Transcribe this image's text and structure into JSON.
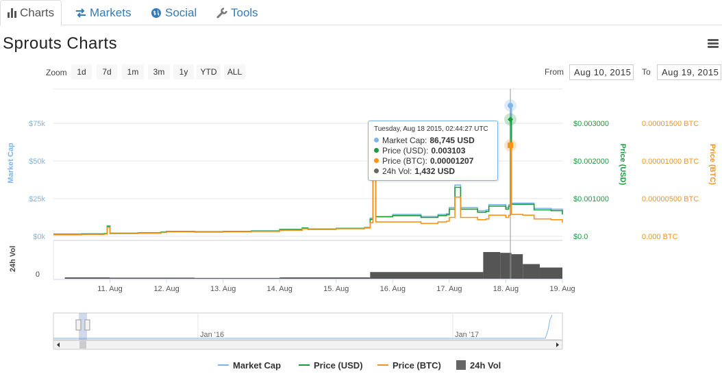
{
  "tabs": [
    {
      "label": "Charts",
      "icon": "bar-chart-icon",
      "active": true
    },
    {
      "label": "Markets",
      "icon": "exchange-icon",
      "active": false
    },
    {
      "label": "Social",
      "icon": "globe-icon",
      "active": false
    },
    {
      "label": "Tools",
      "icon": "wrench-icon",
      "active": false
    }
  ],
  "page": {
    "title": "Sprouts Charts"
  },
  "range_selector": {
    "zoom_label": "Zoom",
    "buttons": [
      "1d",
      "7d",
      "1m",
      "3m",
      "1y",
      "YTD",
      "ALL"
    ],
    "from_label": "From",
    "from_value": "Aug 10, 2015",
    "to_label": "To",
    "to_value": "Aug 19, 2015"
  },
  "tooltip": {
    "header": "Tuesday, Aug 18 2015, 02:44:27 UTC",
    "rows": [
      {
        "label": "Market Cap:",
        "value": "86,745 USD",
        "color": "#7cb5ec"
      },
      {
        "label": "Price (USD):",
        "value": "0.003103",
        "color": "#1a9b3c"
      },
      {
        "label": "Price (BTC):",
        "value": "0.00001207",
        "color": "#f7931a"
      },
      {
        "label": "24h Vol:",
        "value": "1,432 USD",
        "color": "#666666"
      }
    ]
  },
  "chart_data": {
    "type": "line",
    "colors": {
      "market_cap": "#7cb5ec",
      "price_usd": "#1a9b3c",
      "price_btc": "#f7931a",
      "volume": "#555555"
    },
    "x_ticks": [
      "11. Aug",
      "12. Aug",
      "13. Aug",
      "14. Aug",
      "15. Aug",
      "16. Aug",
      "17. Aug",
      "18. Aug",
      "19. Aug"
    ],
    "x_range_days": [
      10.0,
      19.0
    ],
    "axes": {
      "market_cap": {
        "title": "Market Cap",
        "ticks": [
          "$0k",
          "$25k",
          "$50k",
          "$75k"
        ],
        "range": [
          0,
          75000
        ]
      },
      "price_usd": {
        "title": "Price (USD)",
        "ticks": [
          "$0.0",
          "$0.001000",
          "$0.002000",
          "$0.003000"
        ],
        "range": [
          0,
          0.003
        ]
      },
      "price_btc": {
        "title": "Price (BTC)",
        "ticks": [
          "0.000 BTC",
          "0.00000500 BTC",
          "0.00001000 BTC",
          "0.00001500 BTC"
        ],
        "range": [
          0,
          1.5e-05
        ]
      },
      "volume": {
        "title": "24h Vol",
        "ticks": [
          "0"
        ]
      }
    },
    "series": [
      {
        "name": "Market Cap",
        "key": "market_cap",
        "points": [
          [
            10.0,
            1500
          ],
          [
            10.5,
            1700
          ],
          [
            10.9,
            1800
          ],
          [
            10.95,
            7000
          ],
          [
            11.0,
            2000
          ],
          [
            11.5,
            2300
          ],
          [
            11.9,
            2800
          ],
          [
            12.0,
            3200
          ],
          [
            12.5,
            3000
          ],
          [
            13.0,
            3200
          ],
          [
            13.5,
            3600
          ],
          [
            14.0,
            4500
          ],
          [
            14.4,
            5500
          ],
          [
            14.5,
            4800
          ],
          [
            15.0,
            5200
          ],
          [
            15.5,
            5800
          ],
          [
            15.6,
            12000
          ],
          [
            15.65,
            72000
          ],
          [
            15.7,
            13000
          ],
          [
            16.0,
            14500
          ],
          [
            16.5,
            13200
          ],
          [
            16.8,
            14500
          ],
          [
            16.95,
            15000
          ],
          [
            17.0,
            19000
          ],
          [
            17.1,
            34000
          ],
          [
            17.2,
            19000
          ],
          [
            17.5,
            17000
          ],
          [
            17.65,
            17500
          ],
          [
            17.7,
            21000
          ],
          [
            18.0,
            19000
          ],
          [
            18.05,
            21000
          ],
          [
            18.08,
            86745
          ],
          [
            18.1,
            22000
          ],
          [
            18.3,
            22000
          ],
          [
            18.5,
            18500
          ],
          [
            18.8,
            18000
          ],
          [
            19.0,
            15500
          ]
        ]
      },
      {
        "name": "Price (USD)",
        "key": "price_usd",
        "points": [
          [
            10.0,
            5e-05
          ],
          [
            10.5,
            6e-05
          ],
          [
            10.9,
            7e-05
          ],
          [
            10.95,
            0.00026
          ],
          [
            11.0,
            8e-05
          ],
          [
            11.5,
            9e-05
          ],
          [
            11.9,
            0.00011
          ],
          [
            12.0,
            0.00013
          ],
          [
            12.5,
            0.00012
          ],
          [
            13.0,
            0.00013
          ],
          [
            13.5,
            0.00014
          ],
          [
            14.0,
            0.00018
          ],
          [
            14.4,
            0.00022
          ],
          [
            14.5,
            0.00019
          ],
          [
            15.0,
            0.00021
          ],
          [
            15.5,
            0.00023
          ],
          [
            15.6,
            0.00045
          ],
          [
            15.65,
            0.00275
          ],
          [
            15.7,
            0.00052
          ],
          [
            16.0,
            0.00055
          ],
          [
            16.5,
            0.0005
          ],
          [
            16.8,
            0.00055
          ],
          [
            16.95,
            0.00057
          ],
          [
            17.0,
            0.00072
          ],
          [
            17.1,
            0.0013
          ],
          [
            17.2,
            0.00072
          ],
          [
            17.5,
            0.00064
          ],
          [
            17.65,
            0.00066
          ],
          [
            17.7,
            0.0008
          ],
          [
            18.0,
            0.00072
          ],
          [
            18.05,
            0.0008
          ],
          [
            18.08,
            0.003103
          ],
          [
            18.1,
            0.00085
          ],
          [
            18.3,
            0.00085
          ],
          [
            18.5,
            0.0007
          ],
          [
            18.8,
            0.00068
          ],
          [
            19.0,
            0.00058
          ]
        ]
      },
      {
        "name": "Price (BTC)",
        "key": "price_btc",
        "points": [
          [
            10.0,
            2e-07
          ],
          [
            10.5,
            2.5e-07
          ],
          [
            10.9,
            3e-07
          ],
          [
            10.95,
            1.2e-06
          ],
          [
            11.0,
            3.5e-07
          ],
          [
            11.5,
            4e-07
          ],
          [
            11.9,
            5e-07
          ],
          [
            12.0,
            6e-07
          ],
          [
            12.5,
            5.5e-07
          ],
          [
            13.0,
            6e-07
          ],
          [
            13.5,
            6.5e-07
          ],
          [
            14.0,
            8e-07
          ],
          [
            14.4,
            1e-06
          ],
          [
            14.5,
            9e-07
          ],
          [
            15.0,
            1e-06
          ],
          [
            15.5,
            1.1e-06
          ],
          [
            15.6,
            1.8e-06
          ],
          [
            15.65,
            1.3e-05
          ],
          [
            15.7,
            1.9e-06
          ],
          [
            16.0,
            1.9e-06
          ],
          [
            16.5,
            1.7e-06
          ],
          [
            16.8,
            1.9e-06
          ],
          [
            16.95,
            2e-06
          ],
          [
            17.0,
            2.5e-06
          ],
          [
            17.1,
            5.2e-06
          ],
          [
            17.2,
            2.5e-06
          ],
          [
            17.5,
            2.2e-06
          ],
          [
            17.65,
            2.3e-06
          ],
          [
            17.7,
            2.8e-06
          ],
          [
            18.0,
            2.5e-06
          ],
          [
            18.05,
            2.8e-06
          ],
          [
            18.08,
            1.207e-05
          ],
          [
            18.1,
            2.9e-06
          ],
          [
            18.3,
            2.8e-06
          ],
          [
            18.5,
            2.3e-06
          ],
          [
            18.8,
            2.2e-06
          ],
          [
            19.0,
            1.8e-06
          ]
        ]
      }
    ],
    "volume_points": [
      [
        10.2,
        0.05
      ],
      [
        11.0,
        0.04
      ],
      [
        12.5,
        0.03
      ],
      [
        14.0,
        0.05
      ],
      [
        15.6,
        0.25
      ],
      [
        17.6,
        1.0
      ],
      [
        17.9,
        0.97
      ],
      [
        18.1,
        0.92
      ],
      [
        18.3,
        0.55
      ],
      [
        18.6,
        0.42
      ],
      [
        19.0,
        0.35
      ]
    ],
    "navigator": {
      "ticks": [
        "Jan '16",
        "Jan '17"
      ]
    },
    "legend": [
      {
        "label": "Market Cap",
        "kind": "line",
        "color": "#7cb5ec"
      },
      {
        "label": "Price (USD)",
        "kind": "line",
        "color": "#1a9b3c"
      },
      {
        "label": "Price (BTC)",
        "kind": "line",
        "color": "#f7931a"
      },
      {
        "label": "24h Vol",
        "kind": "box",
        "color": "#666666"
      }
    ]
  }
}
